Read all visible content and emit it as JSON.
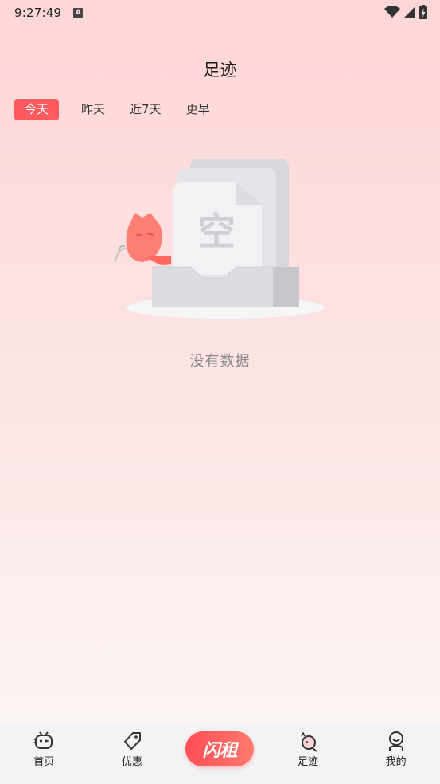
{
  "status_bar": {
    "time": "9:27:49",
    "notification_glyph": "A"
  },
  "header": {
    "title": "足迹"
  },
  "tabs": [
    {
      "label": "今天",
      "active": true
    },
    {
      "label": "昨天",
      "active": false
    },
    {
      "label": "近7天",
      "active": false
    },
    {
      "label": "更早",
      "active": false
    }
  ],
  "empty_state": {
    "illustration_text": "空",
    "message": "没有数据"
  },
  "bottom_nav": {
    "items": [
      {
        "label": "首页",
        "icon": "tv-mascot-icon"
      },
      {
        "label": "优惠",
        "icon": "tag-icon"
      },
      {
        "label": "闪租",
        "icon": "lightning-logo"
      },
      {
        "label": "足迹",
        "icon": "footprint-icon"
      },
      {
        "label": "我的",
        "icon": "smiley-person-icon"
      }
    ]
  },
  "colors": {
    "accent": "#ff5a5f",
    "background_top": "#fed6d7",
    "background_bottom": "#fbf5f3"
  }
}
